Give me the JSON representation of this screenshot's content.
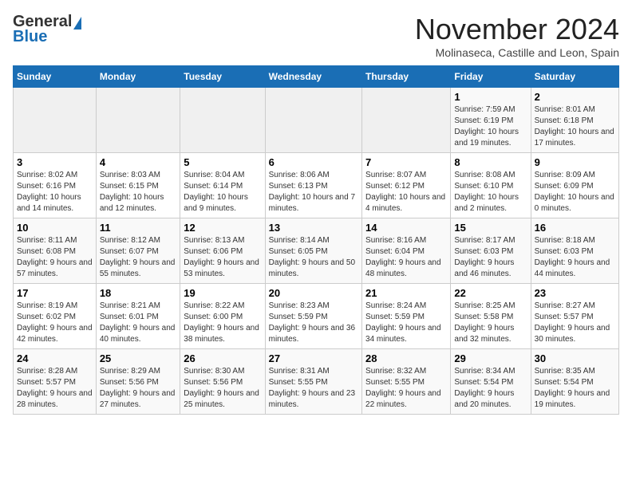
{
  "header": {
    "logo_general": "General",
    "logo_blue": "Blue",
    "month_title": "November 2024",
    "subtitle": "Molinaseca, Castille and Leon, Spain"
  },
  "days_of_week": [
    "Sunday",
    "Monday",
    "Tuesday",
    "Wednesday",
    "Thursday",
    "Friday",
    "Saturday"
  ],
  "weeks": [
    [
      {
        "day": "",
        "info": ""
      },
      {
        "day": "",
        "info": ""
      },
      {
        "day": "",
        "info": ""
      },
      {
        "day": "",
        "info": ""
      },
      {
        "day": "",
        "info": ""
      },
      {
        "day": "1",
        "info": "Sunrise: 7:59 AM\nSunset: 6:19 PM\nDaylight: 10 hours and 19 minutes."
      },
      {
        "day": "2",
        "info": "Sunrise: 8:01 AM\nSunset: 6:18 PM\nDaylight: 10 hours and 17 minutes."
      }
    ],
    [
      {
        "day": "3",
        "info": "Sunrise: 8:02 AM\nSunset: 6:16 PM\nDaylight: 10 hours and 14 minutes."
      },
      {
        "day": "4",
        "info": "Sunrise: 8:03 AM\nSunset: 6:15 PM\nDaylight: 10 hours and 12 minutes."
      },
      {
        "day": "5",
        "info": "Sunrise: 8:04 AM\nSunset: 6:14 PM\nDaylight: 10 hours and 9 minutes."
      },
      {
        "day": "6",
        "info": "Sunrise: 8:06 AM\nSunset: 6:13 PM\nDaylight: 10 hours and 7 minutes."
      },
      {
        "day": "7",
        "info": "Sunrise: 8:07 AM\nSunset: 6:12 PM\nDaylight: 10 hours and 4 minutes."
      },
      {
        "day": "8",
        "info": "Sunrise: 8:08 AM\nSunset: 6:10 PM\nDaylight: 10 hours and 2 minutes."
      },
      {
        "day": "9",
        "info": "Sunrise: 8:09 AM\nSunset: 6:09 PM\nDaylight: 10 hours and 0 minutes."
      }
    ],
    [
      {
        "day": "10",
        "info": "Sunrise: 8:11 AM\nSunset: 6:08 PM\nDaylight: 9 hours and 57 minutes."
      },
      {
        "day": "11",
        "info": "Sunrise: 8:12 AM\nSunset: 6:07 PM\nDaylight: 9 hours and 55 minutes."
      },
      {
        "day": "12",
        "info": "Sunrise: 8:13 AM\nSunset: 6:06 PM\nDaylight: 9 hours and 53 minutes."
      },
      {
        "day": "13",
        "info": "Sunrise: 8:14 AM\nSunset: 6:05 PM\nDaylight: 9 hours and 50 minutes."
      },
      {
        "day": "14",
        "info": "Sunrise: 8:16 AM\nSunset: 6:04 PM\nDaylight: 9 hours and 48 minutes."
      },
      {
        "day": "15",
        "info": "Sunrise: 8:17 AM\nSunset: 6:03 PM\nDaylight: 9 hours and 46 minutes."
      },
      {
        "day": "16",
        "info": "Sunrise: 8:18 AM\nSunset: 6:03 PM\nDaylight: 9 hours and 44 minutes."
      }
    ],
    [
      {
        "day": "17",
        "info": "Sunrise: 8:19 AM\nSunset: 6:02 PM\nDaylight: 9 hours and 42 minutes."
      },
      {
        "day": "18",
        "info": "Sunrise: 8:21 AM\nSunset: 6:01 PM\nDaylight: 9 hours and 40 minutes."
      },
      {
        "day": "19",
        "info": "Sunrise: 8:22 AM\nSunset: 6:00 PM\nDaylight: 9 hours and 38 minutes."
      },
      {
        "day": "20",
        "info": "Sunrise: 8:23 AM\nSunset: 5:59 PM\nDaylight: 9 hours and 36 minutes."
      },
      {
        "day": "21",
        "info": "Sunrise: 8:24 AM\nSunset: 5:59 PM\nDaylight: 9 hours and 34 minutes."
      },
      {
        "day": "22",
        "info": "Sunrise: 8:25 AM\nSunset: 5:58 PM\nDaylight: 9 hours and 32 minutes."
      },
      {
        "day": "23",
        "info": "Sunrise: 8:27 AM\nSunset: 5:57 PM\nDaylight: 9 hours and 30 minutes."
      }
    ],
    [
      {
        "day": "24",
        "info": "Sunrise: 8:28 AM\nSunset: 5:57 PM\nDaylight: 9 hours and 28 minutes."
      },
      {
        "day": "25",
        "info": "Sunrise: 8:29 AM\nSunset: 5:56 PM\nDaylight: 9 hours and 27 minutes."
      },
      {
        "day": "26",
        "info": "Sunrise: 8:30 AM\nSunset: 5:56 PM\nDaylight: 9 hours and 25 minutes."
      },
      {
        "day": "27",
        "info": "Sunrise: 8:31 AM\nSunset: 5:55 PM\nDaylight: 9 hours and 23 minutes."
      },
      {
        "day": "28",
        "info": "Sunrise: 8:32 AM\nSunset: 5:55 PM\nDaylight: 9 hours and 22 minutes."
      },
      {
        "day": "29",
        "info": "Sunrise: 8:34 AM\nSunset: 5:54 PM\nDaylight: 9 hours and 20 minutes."
      },
      {
        "day": "30",
        "info": "Sunrise: 8:35 AM\nSunset: 5:54 PM\nDaylight: 9 hours and 19 minutes."
      }
    ]
  ]
}
